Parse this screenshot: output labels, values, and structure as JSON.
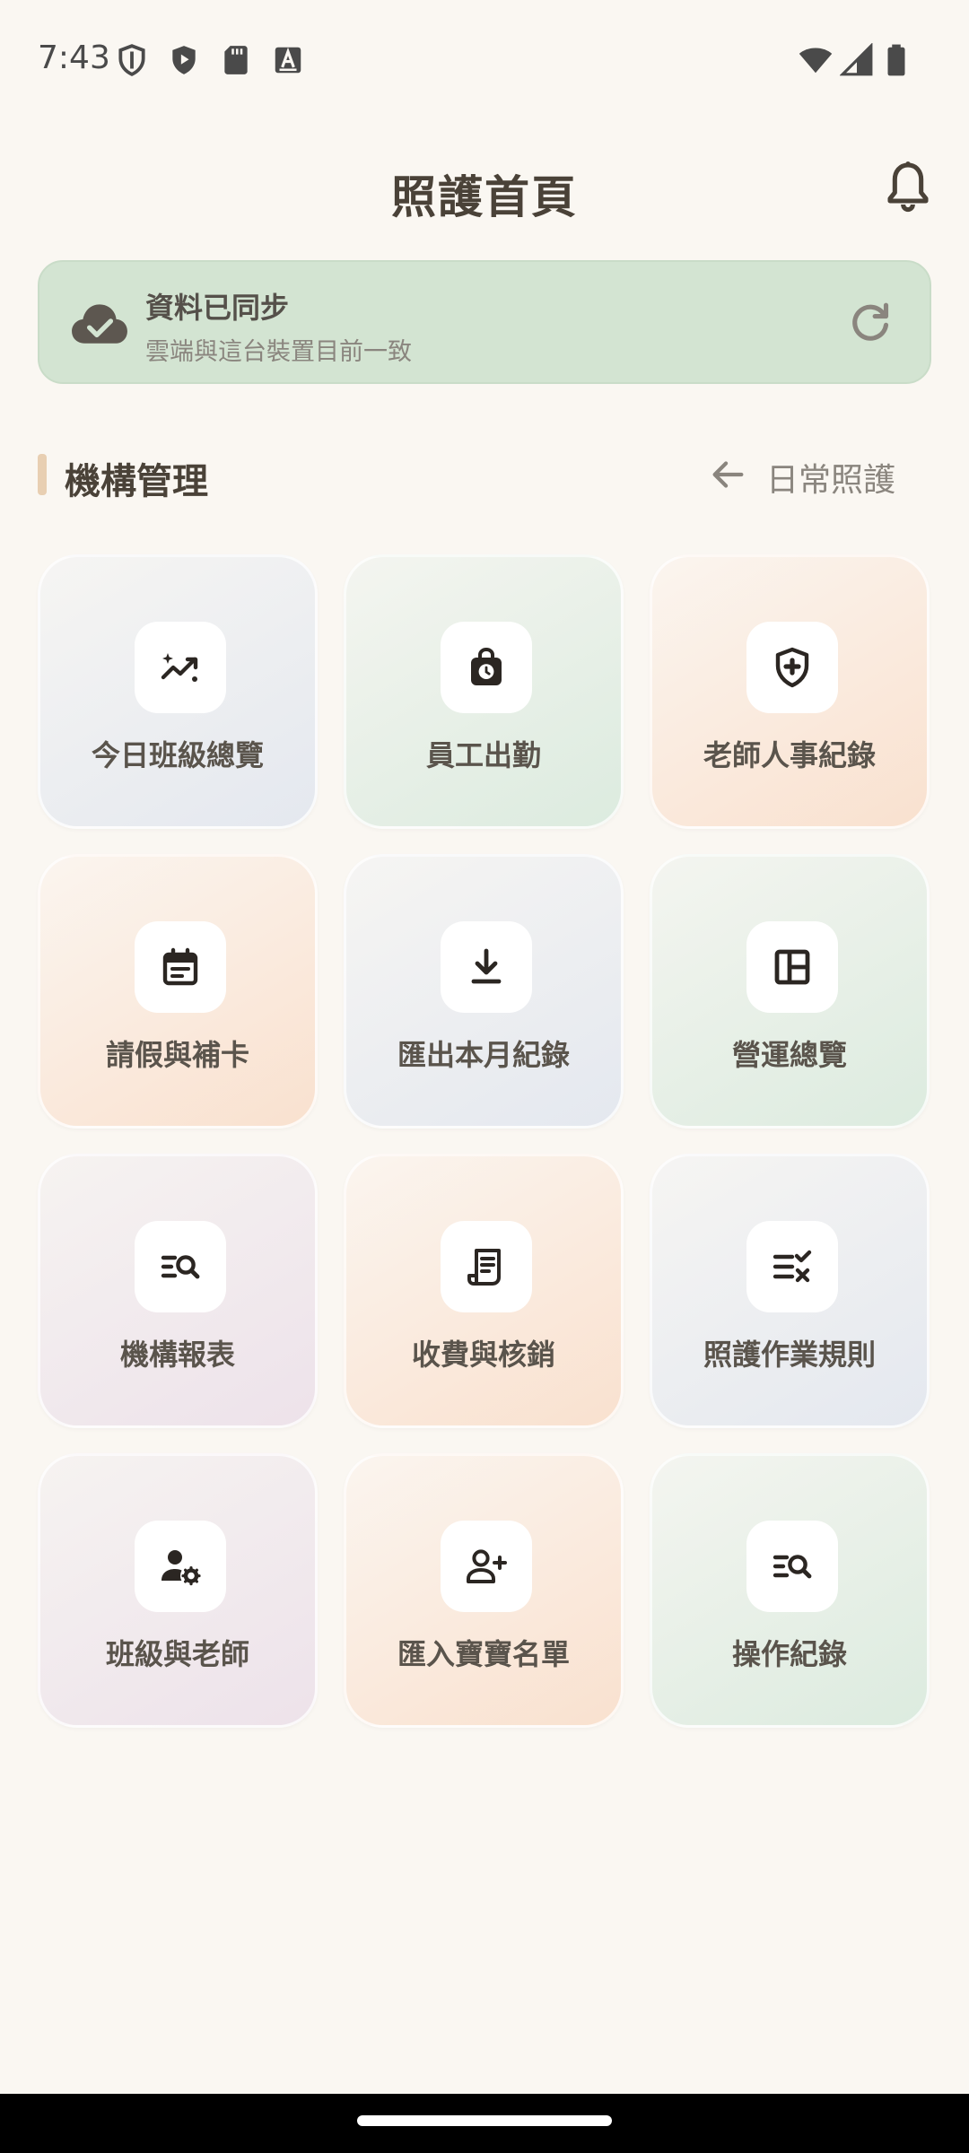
{
  "status_bar": {
    "time": "7:43",
    "left_icons": [
      "shield-outline-icon",
      "play-shield-icon",
      "sd-card-icon",
      "font-box-icon"
    ],
    "right_icons": [
      "wifi-icon",
      "cell-signal-icon",
      "battery-icon"
    ]
  },
  "header": {
    "title": "照護首頁",
    "notification_icon": "bell-icon"
  },
  "sync_banner": {
    "title": "資料已同步",
    "subtitle": "雲端與這台裝置目前一致",
    "status_icon": "cloud-check-icon",
    "action_icon": "refresh-icon",
    "background": "#d3e4d2"
  },
  "section": {
    "title": "機構管理",
    "switch_label": "日常照護",
    "switch_icon": "arrow-left-icon",
    "accent_color": "#e8cfb2"
  },
  "tiles": [
    {
      "label": "今日班級總覽",
      "icon": "trending-sparkle-icon"
    },
    {
      "label": "員工出勤",
      "icon": "bag-clock-icon"
    },
    {
      "label": "老師人事紀錄",
      "icon": "shield-plus-icon"
    },
    {
      "label": "請假與補卡",
      "icon": "calendar-icon"
    },
    {
      "label": "匯出本月紀錄",
      "icon": "download-icon"
    },
    {
      "label": "營運總覽",
      "icon": "dashboard-icon"
    },
    {
      "label": "機構報表",
      "icon": "list-search-icon"
    },
    {
      "label": "收費與核銷",
      "icon": "receipt-icon"
    },
    {
      "label": "照護作業規則",
      "icon": "list-check-icon"
    },
    {
      "label": "班級與老師",
      "icon": "person-gear-icon"
    },
    {
      "label": "匯入寶寶名單",
      "icon": "person-add-icon"
    },
    {
      "label": "操作紀錄",
      "icon": "list-search-icon"
    }
  ],
  "colors": {
    "background": "#faf7f2",
    "text_primary": "#4a4238",
    "text_secondary": "#8a857e",
    "icon_dark": "#2b2622"
  }
}
